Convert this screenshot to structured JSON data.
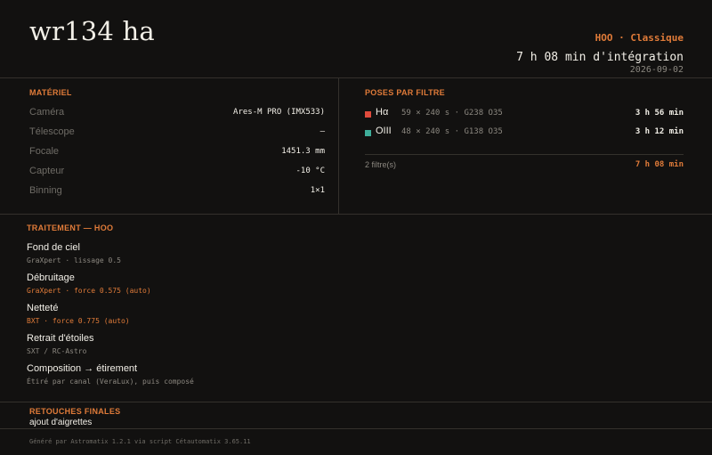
{
  "header": {
    "title": "wr134 ha",
    "mode": "HOO · Classique",
    "integration": "7 h 08 min d'intégration",
    "date": "2026-09-02"
  },
  "materiel": {
    "section_title": "MATÉRIEL",
    "rows": [
      {
        "label": "Caméra",
        "value": "Ares-M PRO (IMX533)"
      },
      {
        "label": "Télescope",
        "value": "—"
      },
      {
        "label": "Focale",
        "value": "1451.3 mm"
      },
      {
        "label": "Capteur",
        "value": "-10 °C"
      },
      {
        "label": "Binning",
        "value": "1×1"
      }
    ]
  },
  "poses": {
    "section_title": "POSES PAR FILTRE",
    "filters": [
      {
        "name": "Hα",
        "detail": "59 × 240 s · G238 O35",
        "time": "3 h 56 min",
        "color": "#e04b3c"
      },
      {
        "name": "OIII",
        "detail": "48 × 240 s · G138 O35",
        "time": "3 h 12 min",
        "color": "#3fae9a"
      }
    ],
    "count": "2 filtre(s)",
    "total": "7 h 08 min"
  },
  "traitement": {
    "section_title": "TRAITEMENT — HOO",
    "steps": [
      {
        "name": "Fond de ciel",
        "detail": "GraXpert · lissage 0.5",
        "highlight": false
      },
      {
        "name": "Débruitage",
        "detail": "GraXpert · force 0.575 (auto)",
        "highlight": true
      },
      {
        "name": "Netteté",
        "detail": "BXT · force 0.775 (auto)",
        "highlight": true
      },
      {
        "name": "Retrait d'étoiles",
        "detail": "SXT / RC-Astro",
        "highlight": false
      },
      {
        "name": "Composition → étirement",
        "detail": "Étiré par canal (VeraLux), puis composé",
        "highlight": false
      }
    ]
  },
  "retouches": {
    "section_title": "RETOUCHES FINALES",
    "text": "ajout d'aigrettes"
  },
  "footer": {
    "text": "Généré par Astromatix 1.2.1 via script Cétautomatix 3.65.11"
  },
  "colors": {
    "accent": "#e07b39",
    "background": "#121110"
  }
}
